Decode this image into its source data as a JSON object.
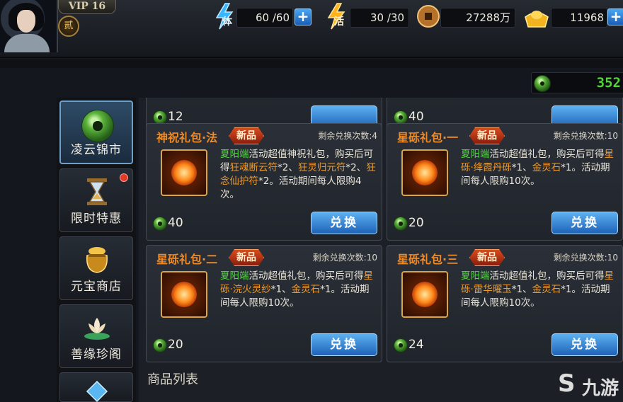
{
  "player": {
    "vip": "VIP 16",
    "rank": "贰"
  },
  "resources": {
    "stamina": {
      "icon": "stamina-lightning-icon",
      "label": "体",
      "value": "60 /60"
    },
    "vitality": {
      "icon": "vitality-lightning-icon",
      "label": "活",
      "value": "30 /30"
    },
    "copper": {
      "icon": "copper-coin-icon",
      "value": "27288万"
    },
    "gold": {
      "icon": "gold-ingot-icon",
      "value": "11968"
    }
  },
  "jade_total": "352",
  "nav": [
    {
      "label": "凌云锦市",
      "icon": "jade-disc-icon",
      "active": true
    },
    {
      "label": "限时特惠",
      "icon": "hourglass-icon",
      "badge": true
    },
    {
      "label": "元宝商店",
      "icon": "treasure-pot-icon"
    },
    {
      "label": "善缘珍阁",
      "icon": "lotus-icon"
    }
  ],
  "partial_prices": [
    "12",
    "40"
  ],
  "cards": [
    {
      "title": "神祝礼包·法",
      "tag": "新品",
      "remain": "剩余兑换次数:4",
      "desc_green": "夏阳端",
      "desc_1": "活动超值神祝礼包，购买后可得",
      "desc_o1": "狂魂断云符",
      "desc_2": "*2、",
      "desc_o2": "狂灵归元符",
      "desc_3": "*2、",
      "desc_o3": "狂念仙护符",
      "desc_4": "*2。活动期间每人限购4次。",
      "price": "40",
      "button": "兑换"
    },
    {
      "title": "星砾礼包·一",
      "tag": "新品",
      "remain": "剩余兑换次数:10",
      "desc_green": "夏阳端",
      "desc_1": "活动超值礼包，购买后可得",
      "desc_o1": "星砾·绛霞丹砾",
      "desc_2": "*1、",
      "desc_o2": "金灵石",
      "desc_3": "*1。活动期间每人限购10次。",
      "price": "20",
      "button": "兑换"
    },
    {
      "title": "星砾礼包·二",
      "tag": "新品",
      "remain": "剩余兑换次数:10",
      "desc_green": "夏阳端",
      "desc_1": "活动超值礼包，购买后可得",
      "desc_o1": "星砾·浣火灵纱",
      "desc_2": "*1、",
      "desc_o2": "金灵石",
      "desc_3": "*1。活动期间每人限购10次。",
      "price": "20",
      "button": "兑换"
    },
    {
      "title": "星砾礼包·三",
      "tag": "新品",
      "remain": "剩余兑换次数:10",
      "desc_green": "夏阳端",
      "desc_1": "活动超值礼包，购买后可得",
      "desc_o1": "星砾·雷华曜玉",
      "desc_2": "*1、",
      "desc_o2": "金灵石",
      "desc_3": "*1。活动期间每人限购10次。",
      "price": "24",
      "button": "兑换"
    }
  ],
  "list_heading": "商品列表",
  "watermark": {
    "glyph": "S",
    "text": "九游"
  }
}
